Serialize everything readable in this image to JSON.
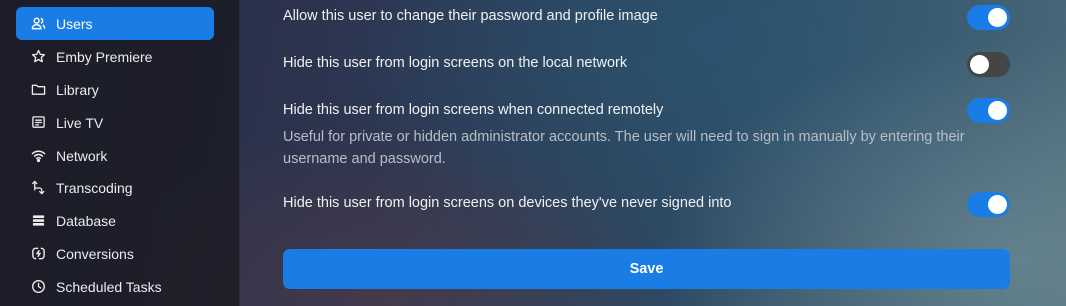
{
  "sidebar": {
    "items": [
      {
        "label": "Users",
        "icon": "users-icon",
        "active": true
      },
      {
        "label": "Emby Premiere",
        "icon": "star-icon",
        "active": false
      },
      {
        "label": "Library",
        "icon": "folder-icon",
        "active": false
      },
      {
        "label": "Live TV",
        "icon": "live-tv-icon",
        "active": false
      },
      {
        "label": "Network",
        "icon": "wifi-icon",
        "active": false
      },
      {
        "label": "Transcoding",
        "icon": "transcode-icon",
        "active": false
      },
      {
        "label": "Database",
        "icon": "database-icon",
        "active": false
      },
      {
        "label": "Conversions",
        "icon": "conversions-icon",
        "active": false
      },
      {
        "label": "Scheduled Tasks",
        "icon": "clock-icon",
        "active": false
      }
    ]
  },
  "settings": [
    {
      "label": "Allow this user to change their password and profile image",
      "enabled": true
    },
    {
      "label": "Hide this user from login screens on the local network",
      "enabled": false
    },
    {
      "label": "Hide this user from login screens when connected remotely",
      "enabled": true,
      "description": "Useful for private or hidden administrator accounts. The user will need to sign in manually by entering their username and password."
    },
    {
      "label": "Hide this user from login screens on devices they've never signed into",
      "enabled": true
    }
  ],
  "save_label": "Save",
  "colors": {
    "accent": "#1a7de6",
    "toggle_off": "#454545"
  }
}
